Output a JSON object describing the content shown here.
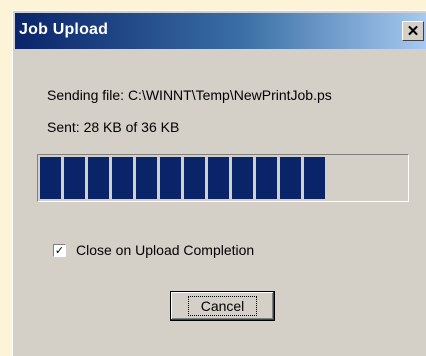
{
  "window": {
    "title": "Job Upload",
    "close_icon": "close-x-icon",
    "close_glyph": "✕"
  },
  "status": {
    "sending_file": "Sending file: C:\\WINNT\\Temp\\NewPrintJob.ps",
    "sent": "Sent: 28 KB of 36 KB"
  },
  "progress": {
    "fraction": 0.777,
    "fill_color": "#0a246a"
  },
  "checkbox": {
    "label": "Close on Upload Completion",
    "checked": true,
    "check_glyph": "✓"
  },
  "buttons": {
    "cancel_label": "Cancel"
  },
  "colors": {
    "dialog_face": "#d4d0c8",
    "title_bar": "#0a246a",
    "page_background": "#fdf3d6"
  }
}
